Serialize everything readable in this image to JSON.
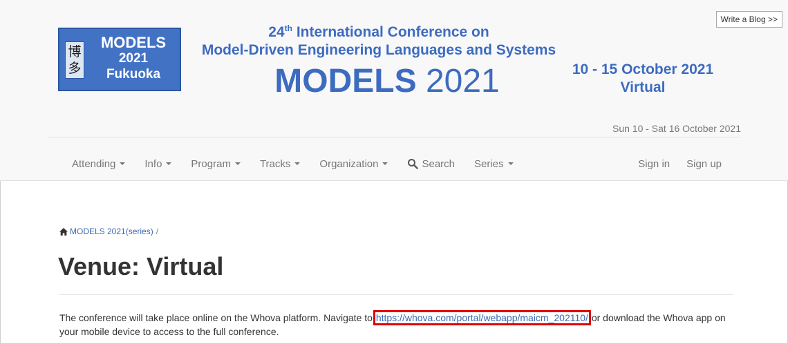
{
  "header": {
    "write_blog": "Write a Blog >>",
    "logo": {
      "kanji_top": "博",
      "kanji_bottom": "多",
      "line1": "MODELS",
      "line2": "2021",
      "line3": "Fukuoka",
      "bg_color": "#4272c4"
    },
    "title_ordinal": "24",
    "title_suffix": "th",
    "title_line1_rest": " International Conference on",
    "title_line2": "Model-Driven Engineering Languages and Systems",
    "big_bold": "MODELS",
    "big_light": " 2021",
    "dates_line1": "10 - 15 October 2021",
    "dates_line2": "Virtual",
    "date_range": "Sun 10 - Sat 16 October 2021",
    "accent_color": "#3d6bc0"
  },
  "nav": {
    "items": [
      {
        "label": "Attending"
      },
      {
        "label": "Info"
      },
      {
        "label": "Program"
      },
      {
        "label": "Tracks"
      },
      {
        "label": "Organization"
      },
      {
        "label": "Search"
      },
      {
        "label": "Series"
      }
    ],
    "sign_in": "Sign in",
    "sign_up": "Sign up"
  },
  "breadcrumb": {
    "link": "MODELS 2021",
    "series": " (series)",
    "sep": "/"
  },
  "page": {
    "title": "Venue: Virtual",
    "para_before": "The conference will take place online on the Whova platform. Navigate to ",
    "link_text": "https://whova.com/portal/webapp/maicm_202110/",
    "para_after": " or download the Whova app on your mobile device to access to the full conference.",
    "highlight_color": "#e10000"
  }
}
